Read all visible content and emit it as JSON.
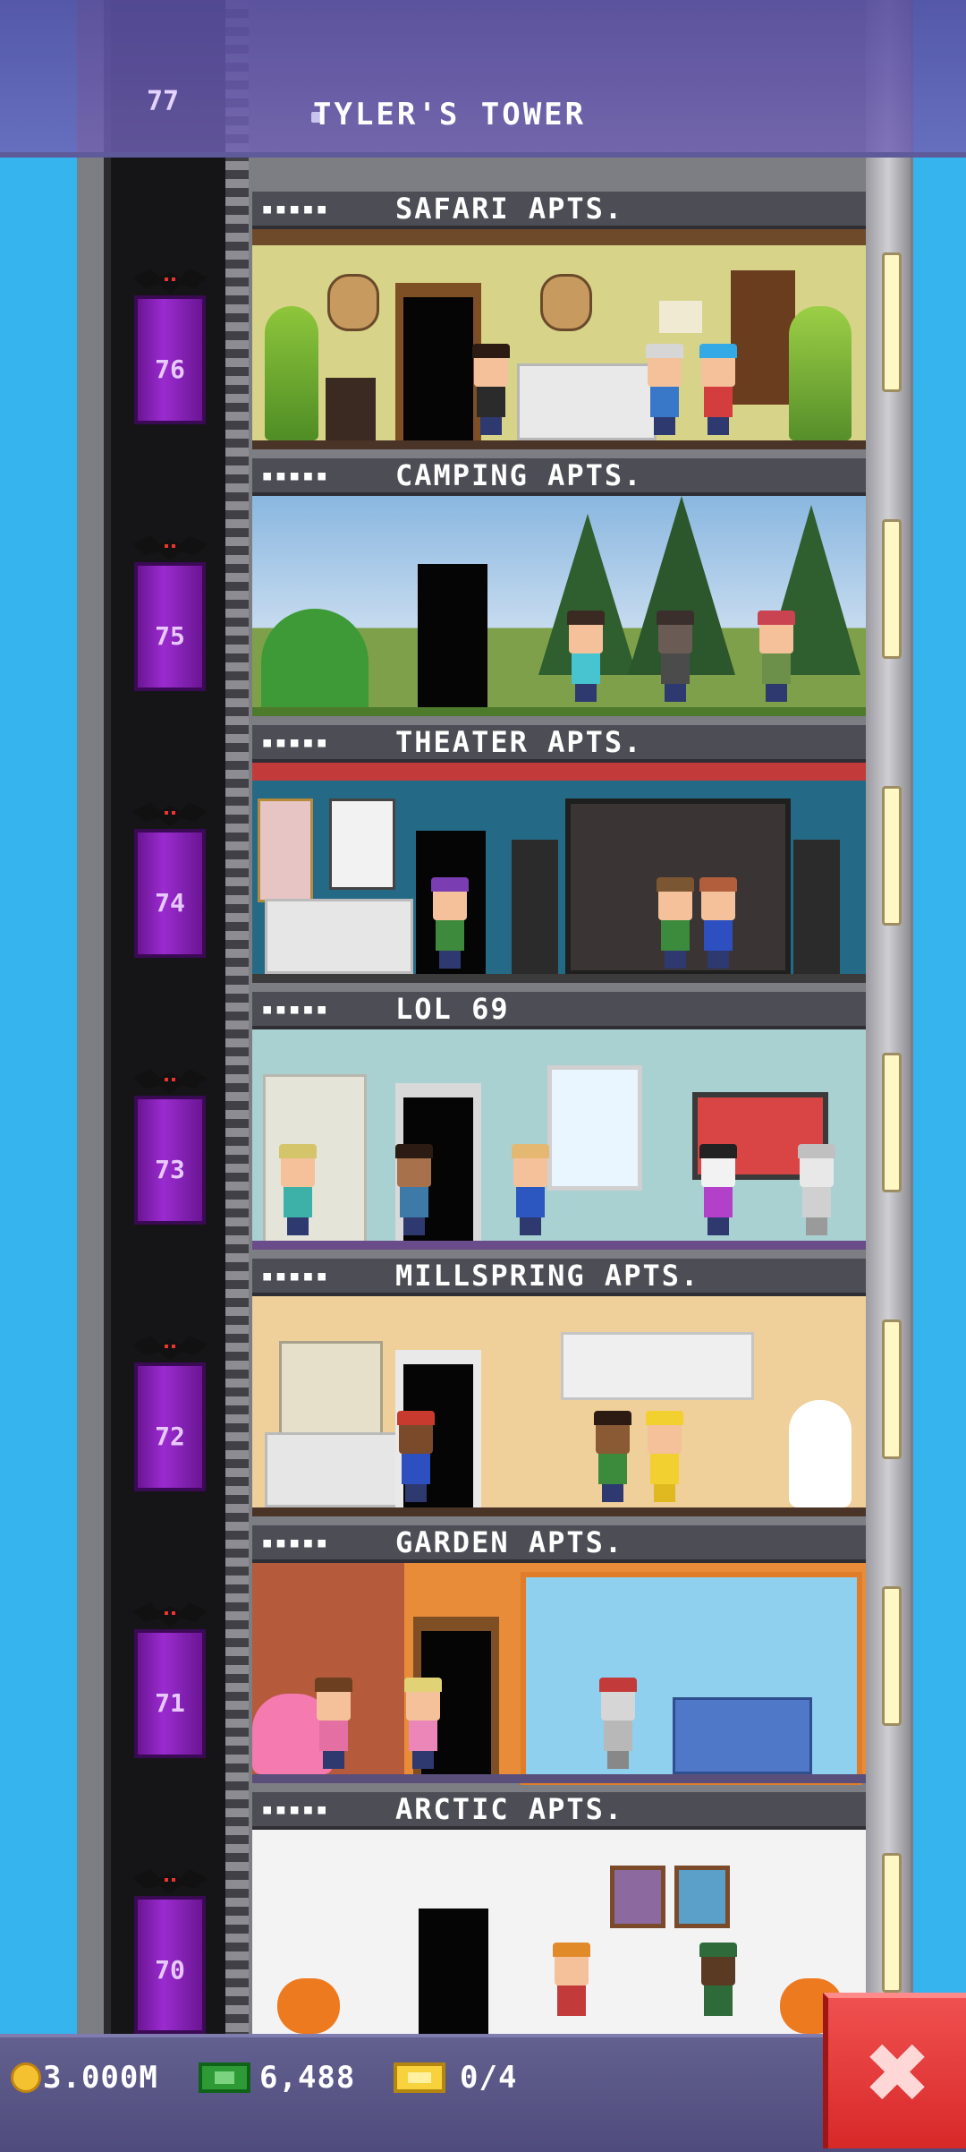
{
  "tower": {
    "title": "TYLER'S TOWER",
    "top_floor_number": "77"
  },
  "floors": [
    {
      "number": "76",
      "name": "SAFARI APTS.",
      "stars": "▪▪▪▪▪"
    },
    {
      "number": "75",
      "name": "CAMPING APTS.",
      "stars": "▪▪▪▪▪"
    },
    {
      "number": "74",
      "name": "THEATER APTS.",
      "stars": "▪▪▪▪▪"
    },
    {
      "number": "73",
      "name": "LOL 69",
      "stars": "▪▪▪▪▪"
    },
    {
      "number": "72",
      "name": "MILLSPRING APTS.",
      "stars": "▪▪▪▪▪"
    },
    {
      "number": "71",
      "name": "GARDEN APTS.",
      "stars": "▪▪▪▪▪"
    },
    {
      "number": "70",
      "name": "ARCTIC APTS.",
      "stars": "▪▪▪▪▪"
    }
  ],
  "stats": {
    "coins": "3.000M",
    "bux": "6,488",
    "tickets": "0/4"
  },
  "close_button": {
    "glyph": "✖"
  },
  "icons": {
    "coin": "coin-icon",
    "bux": "bux-icon",
    "ticket": "ticket-icon",
    "bat": "bat-icon",
    "close": "close-icon"
  },
  "colors": {
    "sky": "#35b4ee",
    "elevator": "#9b2bd0",
    "close": "#e03434",
    "banner": "#6a5fae"
  }
}
